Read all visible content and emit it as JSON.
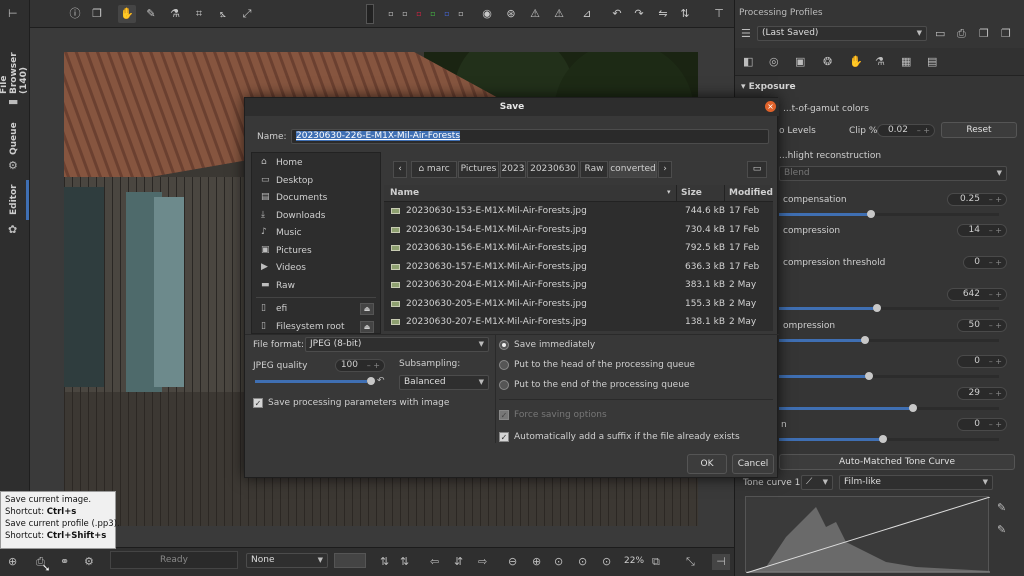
{
  "left_tabs": {
    "file_browser": "File Browser (140)",
    "queue": "Queue",
    "editor": "Editor"
  },
  "right_panel": {
    "title": "Processing Profiles",
    "profile": "(Last Saved)",
    "section": "Exposure",
    "rows": {
      "gamut": "...t-of-gamut colors",
      "auto_levels": "o Levels",
      "clip_label": "Clip %",
      "clip_value": "0.02",
      "reset": "Reset",
      "hl_recon": "...hlight reconstruction",
      "blend": "Blend",
      "exp_comp": "compensation",
      "exp_comp_val": "0.25",
      "hl_comp": "compression",
      "hl_comp_val": "14",
      "hl_thresh": "compression threshold",
      "hl_thresh_val": "0",
      "black_val": "642",
      "shadow_comp": "ompression",
      "shadow_comp_val": "50",
      "v1": "0",
      "v2": "29",
      "sat": "n",
      "v3": "0",
      "auto_tone": "Auto-Matched Tone Curve",
      "tone_label": "Tone curve 1:",
      "tone_mode": "Film-like"
    }
  },
  "bottom": {
    "status": "Ready",
    "none": "None",
    "zoom": "22%"
  },
  "tooltip": {
    "l1": "Save current image.",
    "l2a": "Shortcut: ",
    "l2b": "Ctrl+s",
    "l3": "Save current profile (.pp3).",
    "l4a": "Shortcut: ",
    "l4b": "Ctrl+Shift+s"
  },
  "dialog": {
    "title": "Save",
    "name_label": "Name:",
    "name_value": "20230630-226-E-M1X-Mil-Air-Forests",
    "places": [
      "Home",
      "Desktop",
      "Documents",
      "Downloads",
      "Music",
      "Pictures",
      "Videos",
      "Raw"
    ],
    "devices": [
      "efi",
      "Filesystem root"
    ],
    "breadcrumb": [
      "marc",
      "Pictures",
      "2023",
      "20230630",
      "Raw",
      "converted"
    ],
    "columns": {
      "name": "Name",
      "size": "Size",
      "modified": "Modified"
    },
    "files": [
      {
        "name": "20230630-153-E-M1X-Mil-Air-Forests.jpg",
        "size": "744.6 kB",
        "date": "17 Feb"
      },
      {
        "name": "20230630-154-E-M1X-Mil-Air-Forests.jpg",
        "size": "730.4 kB",
        "date": "17 Feb"
      },
      {
        "name": "20230630-156-E-M1X-Mil-Air-Forests.jpg",
        "size": "792.5 kB",
        "date": "17 Feb"
      },
      {
        "name": "20230630-157-E-M1X-Mil-Air-Forests.jpg",
        "size": "636.3 kB",
        "date": "17 Feb"
      },
      {
        "name": "20230630-204-E-M1X-Mil-Air-Forests.jpg",
        "size": "383.1 kB",
        "date": "2 May"
      },
      {
        "name": "20230630-205-E-M1X-Mil-Air-Forests.jpg",
        "size": "155.3 kB",
        "date": "2 May"
      },
      {
        "name": "20230630-207-E-M1X-Mil-Air-Forests.jpg",
        "size": "138.1 kB",
        "date": "2 May"
      }
    ],
    "file_format_label": "File format:",
    "file_format": "JPEG (8-bit)",
    "jpeg_quality_label": "JPEG quality",
    "jpeg_quality": "100",
    "jpeg_quality_fraction": 1.0,
    "subsampling_label": "Subsampling:",
    "subsampling": "Balanced",
    "save_params": "Save processing parameters with image",
    "save_immediately": "Save immediately",
    "put_head": "Put to the head of the processing queue",
    "put_end": "Put to the end of the processing queue",
    "force_saving": "Force saving options",
    "auto_suffix": "Automatically add a suffix if the file already exists",
    "ok": "OK",
    "cancel": "Cancel"
  }
}
